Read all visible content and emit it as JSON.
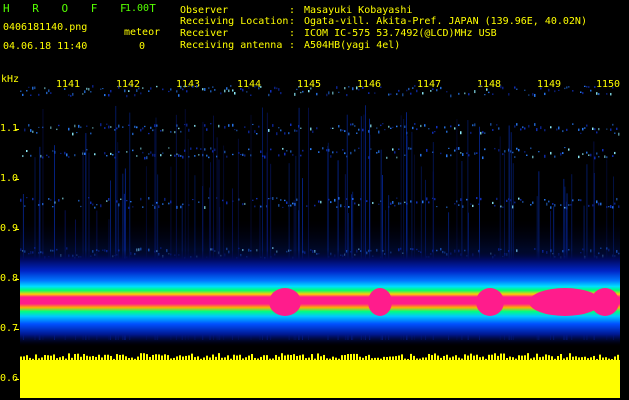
{
  "header": {
    "app_title": "H R O F F T",
    "version": "1.00",
    "filename": "0406181140.png",
    "datetime": "04.06.18 11:40",
    "meteor_label": "meteor",
    "meteor_count": "0"
  },
  "metadata": {
    "observer_label": "Observer",
    "observer_value": "Masayuki Kobayashi",
    "location_label": "Receiving Location",
    "location_value": "Ogata-vill. Akita-Pref. JAPAN (139.96E, 40.02N)",
    "receiver_label": "Receiver",
    "receiver_value": "ICOM IC-575 53.7492(@LCD)MHz USB",
    "antenna_label": "Receiving antenna",
    "antenna_value": "A504HB(yagi 4el)",
    "separator": ":"
  },
  "axes": {
    "y_unit": "kHz",
    "y_ticks": [
      "1.1",
      "1.0",
      "0.9",
      "0.8",
      "0.7",
      "0.6"
    ],
    "x_ticks": [
      "1141",
      "1142",
      "1143",
      "1144",
      "1145",
      "1146",
      "1147",
      "1148",
      "1149",
      "1150"
    ]
  },
  "colors": {
    "text": "#ffff00",
    "title": "#55ff00",
    "background": "#000000",
    "band_core": "#ff0080",
    "band_mid": "#00ff60",
    "band_outer": "#0040ff",
    "noise_floor": "#ffff00"
  }
}
